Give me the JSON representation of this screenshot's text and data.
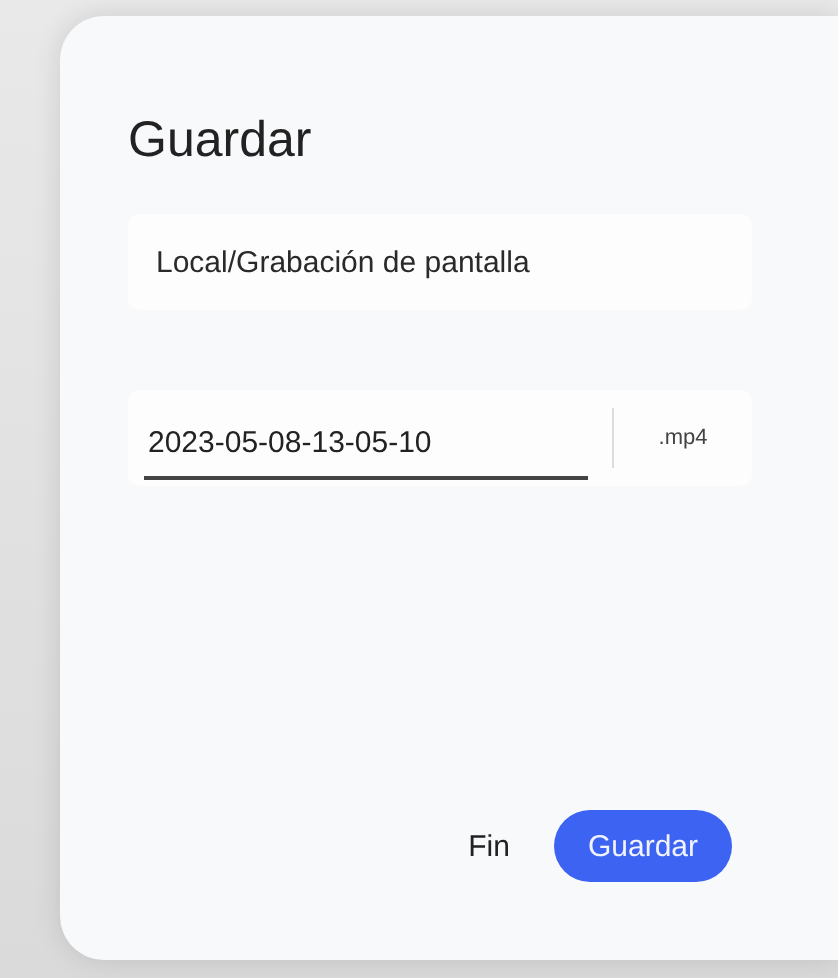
{
  "dialog": {
    "title": "Guardar",
    "location": "Local/Grabación de pantalla",
    "filename": {
      "value": "2023-05-08-13-05-10",
      "extension": ".mp4"
    },
    "buttons": [
      {
        "label": "Fin",
        "kind": "text"
      },
      {
        "label": "Guardar",
        "kind": "primary"
      }
    ]
  }
}
